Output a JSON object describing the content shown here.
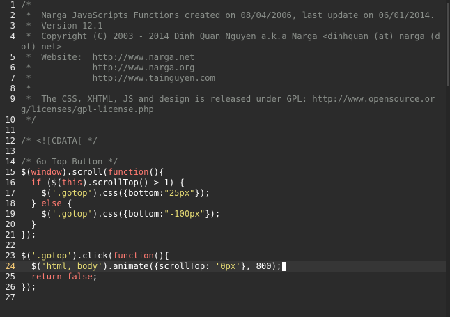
{
  "editor": {
    "current_line": 24,
    "lines": [
      {
        "num": "1",
        "segments": [
          {
            "t": "/*",
            "c": "comment"
          }
        ]
      },
      {
        "num": "2",
        "segments": [
          {
            "t": " *  Narga JavaScripts Functions created on 08/04/2006, last update on 06/01/2014.",
            "c": "comment"
          }
        ]
      },
      {
        "num": "3",
        "segments": [
          {
            "t": " *  Version 12.1",
            "c": "comment"
          }
        ]
      },
      {
        "num": "4",
        "segments": [
          {
            "t": " *  Copyright (C) 2003 - 2014 Dinh Quan Nguyen a.k.a Narga <dinhquan (at) narga (dot) net>",
            "c": "comment"
          }
        ]
      },
      {
        "num": "5",
        "segments": [
          {
            "t": " *  Website:  http://www.narga.net",
            "c": "comment"
          }
        ]
      },
      {
        "num": "6",
        "segments": [
          {
            "t": " *            http://www.narga.org",
            "c": "comment"
          }
        ]
      },
      {
        "num": "7",
        "segments": [
          {
            "t": " *            http://www.tainguyen.com",
            "c": "comment"
          }
        ]
      },
      {
        "num": "8",
        "segments": [
          {
            "t": " *",
            "c": "comment"
          }
        ]
      },
      {
        "num": "9",
        "segments": [
          {
            "t": " *  The CSS, XHTML, JS and design is released under GPL: http://www.opensource.org/licenses/gpl-license.php",
            "c": "comment"
          }
        ]
      },
      {
        "num": "10",
        "segments": [
          {
            "t": " */",
            "c": "comment"
          }
        ]
      },
      {
        "num": "11",
        "segments": [
          {
            "t": "",
            "c": "plain"
          }
        ]
      },
      {
        "num": "12",
        "segments": [
          {
            "t": "/* <![CDATA[ */",
            "c": "comment"
          }
        ]
      },
      {
        "num": "13",
        "segments": [
          {
            "t": "",
            "c": "plain"
          }
        ]
      },
      {
        "num": "14",
        "segments": [
          {
            "t": "/* Go Top Button */",
            "c": "comment"
          }
        ]
      },
      {
        "num": "15",
        "segments": [
          {
            "t": "$(",
            "c": "plain"
          },
          {
            "t": "window",
            "c": "builtin"
          },
          {
            "t": ").scroll(",
            "c": "plain"
          },
          {
            "t": "function",
            "c": "keyword"
          },
          {
            "t": "(){",
            "c": "plain"
          }
        ]
      },
      {
        "num": "16",
        "segments": [
          {
            "t": "  ",
            "c": "plain"
          },
          {
            "t": "if",
            "c": "keyword"
          },
          {
            "t": " ($(",
            "c": "plain"
          },
          {
            "t": "this",
            "c": "builtin"
          },
          {
            "t": ").scrollTop() > 1) {",
            "c": "plain"
          }
        ]
      },
      {
        "num": "17",
        "segments": [
          {
            "t": "    $(",
            "c": "plain"
          },
          {
            "t": "'.gotop'",
            "c": "string"
          },
          {
            "t": ").css({bottom:",
            "c": "plain"
          },
          {
            "t": "\"25px\"",
            "c": "string"
          },
          {
            "t": "});",
            "c": "plain"
          }
        ]
      },
      {
        "num": "18",
        "segments": [
          {
            "t": "  } ",
            "c": "plain"
          },
          {
            "t": "else",
            "c": "keyword"
          },
          {
            "t": " {",
            "c": "plain"
          }
        ]
      },
      {
        "num": "19",
        "segments": [
          {
            "t": "    $(",
            "c": "plain"
          },
          {
            "t": "'.gotop'",
            "c": "string"
          },
          {
            "t": ").css({bottom:",
            "c": "plain"
          },
          {
            "t": "\"-100px\"",
            "c": "string"
          },
          {
            "t": "});",
            "c": "plain"
          }
        ]
      },
      {
        "num": "20",
        "segments": [
          {
            "t": "  }",
            "c": "plain"
          }
        ]
      },
      {
        "num": "21",
        "segments": [
          {
            "t": "});",
            "c": "plain"
          }
        ]
      },
      {
        "num": "22",
        "segments": [
          {
            "t": "",
            "c": "plain"
          }
        ]
      },
      {
        "num": "23",
        "segments": [
          {
            "t": "$(",
            "c": "plain"
          },
          {
            "t": "'.gotop'",
            "c": "string"
          },
          {
            "t": ").click(",
            "c": "plain"
          },
          {
            "t": "function",
            "c": "keyword"
          },
          {
            "t": "(){",
            "c": "plain"
          }
        ]
      },
      {
        "num": "24",
        "segments": [
          {
            "t": "  $(",
            "c": "plain"
          },
          {
            "t": "'html, body'",
            "c": "string"
          },
          {
            "t": ").animate({scrollTop: ",
            "c": "plain"
          },
          {
            "t": "'0px'",
            "c": "string"
          },
          {
            "t": "}, 800);",
            "c": "plain"
          }
        ]
      },
      {
        "num": "25",
        "segments": [
          {
            "t": "  ",
            "c": "plain"
          },
          {
            "t": "return",
            "c": "keyword"
          },
          {
            "t": " ",
            "c": "plain"
          },
          {
            "t": "false",
            "c": "keyword"
          },
          {
            "t": ";",
            "c": "plain"
          }
        ]
      },
      {
        "num": "26",
        "segments": [
          {
            "t": "});",
            "c": "plain"
          }
        ]
      },
      {
        "num": "27",
        "segments": [
          {
            "t": "",
            "c": "plain"
          }
        ]
      }
    ]
  },
  "colors": {
    "background": "#2b2b2b",
    "comment": "#8a8f8a",
    "keyword": "#ff7b72",
    "string": "#e6db74",
    "current_line_bg": "#363636"
  }
}
